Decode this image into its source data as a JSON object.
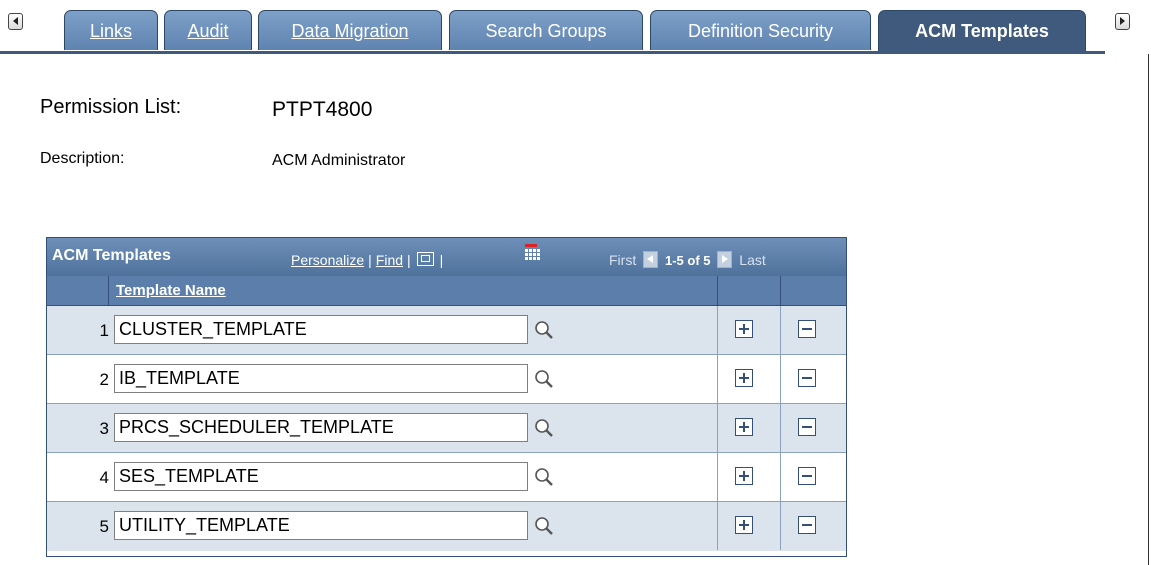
{
  "tabs": [
    {
      "label": "Links",
      "active": false
    },
    {
      "label": "Audit",
      "active": false
    },
    {
      "label": "Data Migration",
      "active": false
    },
    {
      "label": "Search Groups",
      "active": false
    },
    {
      "label": "Definition Security",
      "active": false
    },
    {
      "label": "ACM Templates",
      "active": true
    }
  ],
  "header": {
    "permission_list_label": "Permission List:",
    "permission_list_value": "PTPT4800",
    "description_label": "Description:",
    "description_value": "ACM Administrator"
  },
  "grid": {
    "title": "ACM Templates",
    "personalize_label": "Personalize",
    "find_label": "Find",
    "nav_first": "First",
    "nav_count": "1-5 of 5",
    "nav_last": "Last",
    "column_template_name": "Template Name",
    "rows": [
      {
        "num": "1",
        "value": "CLUSTER_TEMPLATE"
      },
      {
        "num": "2",
        "value": "IB_TEMPLATE"
      },
      {
        "num": "3",
        "value": "PRCS_SCHEDULER_TEMPLATE"
      },
      {
        "num": "4",
        "value": "SES_TEMPLATE"
      },
      {
        "num": "5",
        "value": "UTILITY_TEMPLATE"
      }
    ]
  },
  "colors": {
    "tab_active": "#3f5a7d",
    "tab_inactive": "#6d91bb",
    "grid_header": "#5b7faa",
    "row_shaded": "#dbe4ec"
  },
  "icons": [
    "scroll-left-icon",
    "scroll-right-icon",
    "zoom-grid-icon",
    "download-grid-icon",
    "prev-page-icon",
    "next-page-icon",
    "lookup-icon",
    "add-row-icon",
    "delete-row-icon"
  ]
}
